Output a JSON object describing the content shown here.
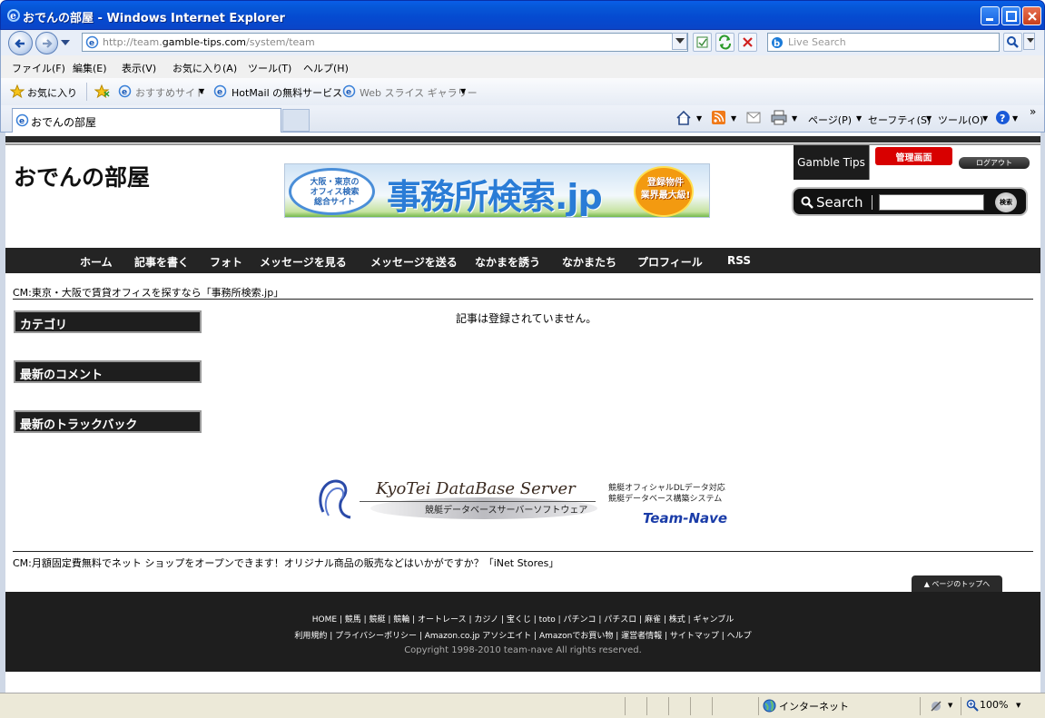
{
  "window": {
    "title": "おでんの部屋 - Windows Internet Explorer"
  },
  "address": {
    "url_prefix": "http://team.",
    "url_domain": "gamble-tips.com",
    "url_path": "/system/team"
  },
  "search": {
    "placeholder": "Live Search"
  },
  "menu": [
    "ファイル(F)",
    "編集(E)",
    "表示(V)",
    "お気に入り(A)",
    "ツール(T)",
    "ヘルプ(H)"
  ],
  "favorites": {
    "label": "お気に入り",
    "suggested": "おすすめサイト",
    "hotmail": "HotMail の無料サービス",
    "webslice": "Web スライス ギャラリー"
  },
  "tab": {
    "label": "おでんの部屋"
  },
  "commandbar": {
    "page": "ページ(P)",
    "safety": "セーフティ(S)",
    "tools": "ツール(O)"
  },
  "site": {
    "title": "おでんの部屋",
    "banner": {
      "oval": "大阪・東京の\nオフィス検索\n総合サイト",
      "main": "事務所検索.jp",
      "burst": "登録物件\n業界最大級!"
    },
    "gamble_tips": "Gamble Tips",
    "admin": "管理画面",
    "logout": "ログアウト",
    "search_label": "Search",
    "search_button": "検索"
  },
  "nav": [
    "ホーム",
    "記事を書く",
    "フォト",
    "メッセージを見る",
    "メッセージを送る",
    "なかまを誘う",
    "なかまたち",
    "プロフィール",
    "RSS"
  ],
  "cm_top": "CM:東京・大阪で賃貸オフィスを探すなら「事務所検索.jp」",
  "sidebar": [
    "カテゴリ",
    "最新のコメント",
    "最新のトラックバック"
  ],
  "main": {
    "empty_message": "記事は登録されていません。"
  },
  "kyotei": {
    "title": "KyoTei DataBase Server",
    "subtitle": "競艇データベースサーバーソフトウェア",
    "line1": "競艇オフィシャルDLデータ対応",
    "line2": "競艇データベース構築システム",
    "brand": "Team-Nave"
  },
  "cm_bottom": "CM:月額固定費無料でネット ショップをオープンできます！オリジナル商品の販売などはいかがですか？「iNet Stores」",
  "to_top": "▲ ページのトップへ",
  "footer": {
    "links1": "HOME | 競馬 | 競艇 | 競輪 | オートレース | カジノ | 宝くじ | toto | パチンコ | パチスロ | 麻雀 | 株式 | ギャンブル",
    "links2": "利用規約 | プライバシーポリシー | Amazon.co.jp アソシエイト | Amazonでお買い物 | 運営者情報 | サイトマップ | ヘルプ",
    "copyright": "Copyright 1998-2010 team-nave All rights reserved."
  },
  "status": {
    "zone": "インターネット",
    "zoom": "100%"
  },
  "colors": {
    "titlebar": "#0658d8",
    "nav_bg": "#242424",
    "admin_red": "#d80000",
    "brand_blue": "#1a3ca8"
  }
}
